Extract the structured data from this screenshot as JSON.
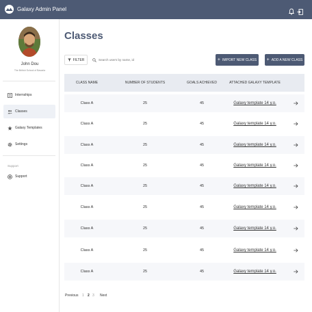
{
  "app": {
    "title": "Galaxy Admin Panel"
  },
  "colors": {
    "primary": "#4d5a74",
    "header_bg": "#e8ebf1",
    "active_nav": "#eef1f6"
  },
  "user": {
    "name": "John Dou",
    "school": "The British School of Bavaria"
  },
  "sidebar": {
    "items": [
      {
        "label": "Internships",
        "icon": "internship-icon",
        "active": false
      },
      {
        "label": "Classes",
        "icon": "people-icon",
        "active": true
      },
      {
        "label": "Galaxy Templates",
        "icon": "star-icon",
        "active": false
      },
      {
        "label": "Settings",
        "icon": "gear-icon",
        "active": false
      }
    ],
    "support_heading": "Support",
    "support_item": {
      "label": "Support",
      "icon": "lifebuoy-icon"
    }
  },
  "main": {
    "title": "Classes",
    "filter_label": "FILTER",
    "search_placeholder": "Search users by name, id",
    "import_label": "IMPORT NEW CLASS",
    "add_label": "ADD A NEW CLASS"
  },
  "table": {
    "columns": [
      "CLASS NAME",
      "NUMBER OF STUDENTS",
      "GOALS ACHIEVED",
      "ATTACHED GALAXY TEMPLATE"
    ],
    "rows": [
      {
        "class_name": "Class A",
        "students": "25",
        "goals": "45",
        "template": "Galaxy template 14 y.o."
      },
      {
        "class_name": "Class A",
        "students": "25",
        "goals": "45",
        "template": "Galaxy template 14 y.o."
      },
      {
        "class_name": "Class A",
        "students": "25",
        "goals": "45",
        "template": "Galaxy template 14 y.o."
      },
      {
        "class_name": "Class A",
        "students": "25",
        "goals": "45",
        "template": "Galaxy template 14 y.o."
      },
      {
        "class_name": "Class A",
        "students": "25",
        "goals": "45",
        "template": "Galaxy template 14 y.o."
      },
      {
        "class_name": "Class A",
        "students": "25",
        "goals": "45",
        "template": "Galaxy template 14 y.o."
      },
      {
        "class_name": "Class A",
        "students": "25",
        "goals": "45",
        "template": "Galaxy template 14 y.o."
      },
      {
        "class_name": "Class A",
        "students": "25",
        "goals": "45",
        "template": "Galaxy template 14 y.o."
      },
      {
        "class_name": "Class A",
        "students": "25",
        "goals": "45",
        "template": "Galaxy template 14 y.o."
      }
    ]
  },
  "pagination": {
    "previous": "Previous",
    "pages": [
      "1",
      "2",
      "3"
    ],
    "current": "2",
    "next": "Next"
  }
}
